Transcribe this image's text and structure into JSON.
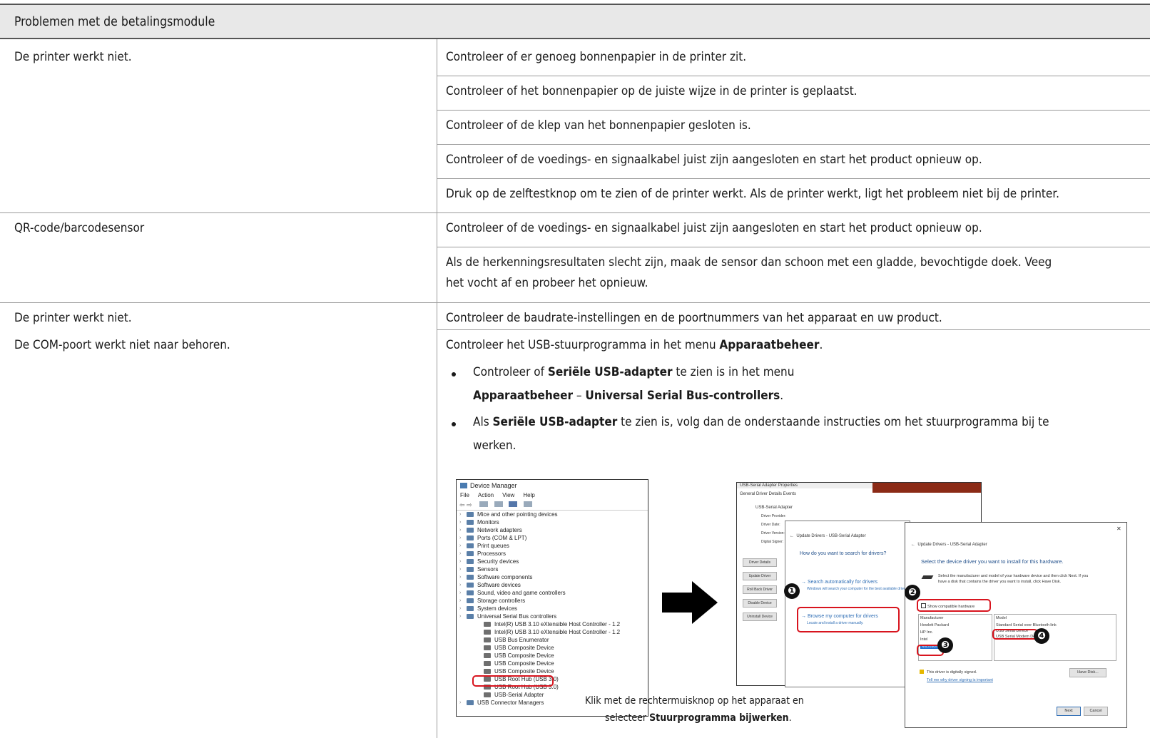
{
  "table": {
    "header": "Problemen met de betalingsmodule",
    "printer_left": "De printer werkt niet.",
    "printer_fixes": [
      "Controleer of er genoeg bonnenpapier in de printer zit.",
      "Controleer of het bonnenpapier op de juiste wijze in de printer is geplaatst.",
      "Controleer of de klep van het bonnenpapier gesloten is.",
      "Controleer of de voedings- en signaalkabel juist zijn aangesloten en start het product opnieuw op.",
      "Druk op de zelftestknop om te zien of de printer werkt. Als de printer werkt, ligt het probleem niet bij de printer."
    ],
    "qr_left": "QR-code/barcodesensor",
    "qr_fixes": [
      "Controleer of de voedings- en signaalkabel juist zijn aangesloten en start het product opnieuw op.",
      "Als de herkenningsresultaten slecht zijn, maak de sensor dan schoon met een gladde, bevochtigde doek. Veeg",
      "het vocht af en probeer het opnieuw."
    ],
    "com_left_1": "De printer werkt niet.",
    "com_left_2": "De COM-poort werkt niet naar behoren.",
    "com_fix_1": "Controleer de baudrate-instellingen en de poortnummers van het apparaat en uw product.",
    "com_fix_2_pre": "Controleer het USB-stuurprogramma in het menu ",
    "com_fix_2_bold": "Apparaatbeheer",
    "com_fix_2_post": ".",
    "bullet1_pre": "Controleer of ",
    "bullet1_bold1": "Seriële USB-adapter",
    "bullet1_mid": " te zien is in het menu",
    "bullet1_bold2": "Apparaatbeheer",
    "bullet1_dash": " – ",
    "bullet1_bold3": "Universal Serial Bus-controllers",
    "bullet1_end": ".",
    "bullet2_pre": "Als ",
    "bullet2_bold": "Seriële USB-adapter",
    "bullet2_post": " te zien is, volg dan de onderstaande instructies om het stuurprogramma bij te",
    "bullet2_line2": "werken.",
    "caption_1": "Klik met de rechtermuisknop op het apparaat en",
    "caption_2_pre": "selecteer ",
    "caption_2_bold": "Stuurprogramma bijwerken",
    "caption_2_post": "."
  },
  "device_manager": {
    "title": "Device Manager",
    "menu": [
      "File",
      "Action",
      "View",
      "Help"
    ],
    "items": [
      {
        "label": "Mice and other pointing devices",
        "indent": 0
      },
      {
        "label": "Monitors",
        "indent": 0
      },
      {
        "label": "Network adapters",
        "indent": 0
      },
      {
        "label": "Ports (COM & LPT)",
        "indent": 0
      },
      {
        "label": "Print queues",
        "indent": 0
      },
      {
        "label": "Processors",
        "indent": 0
      },
      {
        "label": "Security devices",
        "indent": 0
      },
      {
        "label": "Sensors",
        "indent": 0
      },
      {
        "label": "Software components",
        "indent": 0
      },
      {
        "label": "Software devices",
        "indent": 0
      },
      {
        "label": "Sound, video and game controllers",
        "indent": 0
      },
      {
        "label": "Storage controllers",
        "indent": 0
      },
      {
        "label": "System devices",
        "indent": 0
      },
      {
        "label": "Universal Serial Bus controllers",
        "indent": 0
      },
      {
        "label": "Intel(R) USB 3.10 eXtensible Host Controller - 1.2",
        "indent": 1
      },
      {
        "label": "Intel(R) USB 3.10 eXtensible Host Controller - 1.2",
        "indent": 1
      },
      {
        "label": "USB Bus Enumerator",
        "indent": 1
      },
      {
        "label": "USB Composite Device",
        "indent": 1
      },
      {
        "label": "USB Composite Device",
        "indent": 1
      },
      {
        "label": "USB Composite Device",
        "indent": 1
      },
      {
        "label": "USB Composite Device",
        "indent": 1
      },
      {
        "label": "USB Root Hub (USB 3.0)",
        "indent": 1
      },
      {
        "label": "USB Root Hub (USB 3.0)",
        "indent": 1
      },
      {
        "label": "USB-Serial Adapter",
        "indent": 1
      },
      {
        "label": "USB Connector Managers",
        "indent": 0
      }
    ]
  },
  "properties": {
    "title": "USB-Serial Adapter Properties",
    "tabs": "General  Driver  Details  Events",
    "device": "USB-Serial Adapter",
    "fields": [
      "Driver Provider:",
      "Driver Date:",
      "Driver Version:",
      "Digital Signer:"
    ],
    "buttons": [
      "Driver Details",
      "Update Driver",
      "Roll Back Driver",
      "Disable Device",
      "Uninstall Device"
    ]
  },
  "update1": {
    "title": "Update Drivers - USB-Serial Adapter",
    "question": "How do you want to search for drivers?",
    "opt1": "→ Search automatically for drivers",
    "opt1_sub": "Windows will search your computer for the best available driver and install it on your device.",
    "opt2": "→ Browse my computer for drivers",
    "opt2_sub": "Locate and install a driver manually."
  },
  "update2": {
    "title": "Update Drivers - USB-Serial Adapter",
    "heading": "Select the device driver you want to install for this hardware.",
    "desc1": "Select the manufacturer and model of your hardware device and then click Next. If you",
    "desc2": "have a disk that contains the driver you want to install, click Have Disk.",
    "checkbox": "Show compatible hardware",
    "manufacturer_hdr": "Manufacturer",
    "manufacturers": [
      "Hewlett Packard",
      "HP Inc.",
      "Intel",
      "Microsoft"
    ],
    "model_hdr": "Model",
    "models": [
      "Standard Serial over Bluetooth link",
      "USB Serial Device",
      "USB Serial Modem Device"
    ],
    "signed": "This driver is digitally signed.",
    "signing_link": "Tell me why driver signing is important",
    "have_disk": "Have Disk...",
    "next": "Next",
    "cancel": "Cancel"
  },
  "badges": [
    "❶",
    "❷",
    "❸",
    "❹"
  ]
}
